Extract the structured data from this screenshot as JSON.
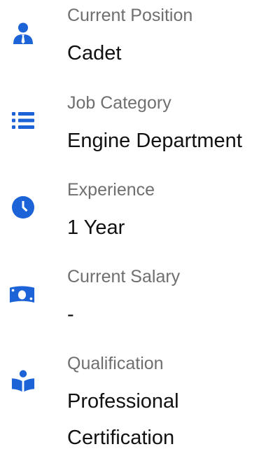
{
  "accent_color": "#1b63d6",
  "details": [
    {
      "icon": "user-tie-icon",
      "label": "Current Position",
      "value": "Cadet"
    },
    {
      "icon": "list-icon",
      "label": "Job Category",
      "value": "Engine Department"
    },
    {
      "icon": "clock-icon",
      "label": "Experience",
      "value": "1 Year"
    },
    {
      "icon": "money-bill-icon",
      "label": "Current Salary",
      "value": "-"
    },
    {
      "icon": "book-reader-icon",
      "label": "Qualification",
      "value_lines": [
        "Professional",
        "Certification"
      ]
    }
  ]
}
